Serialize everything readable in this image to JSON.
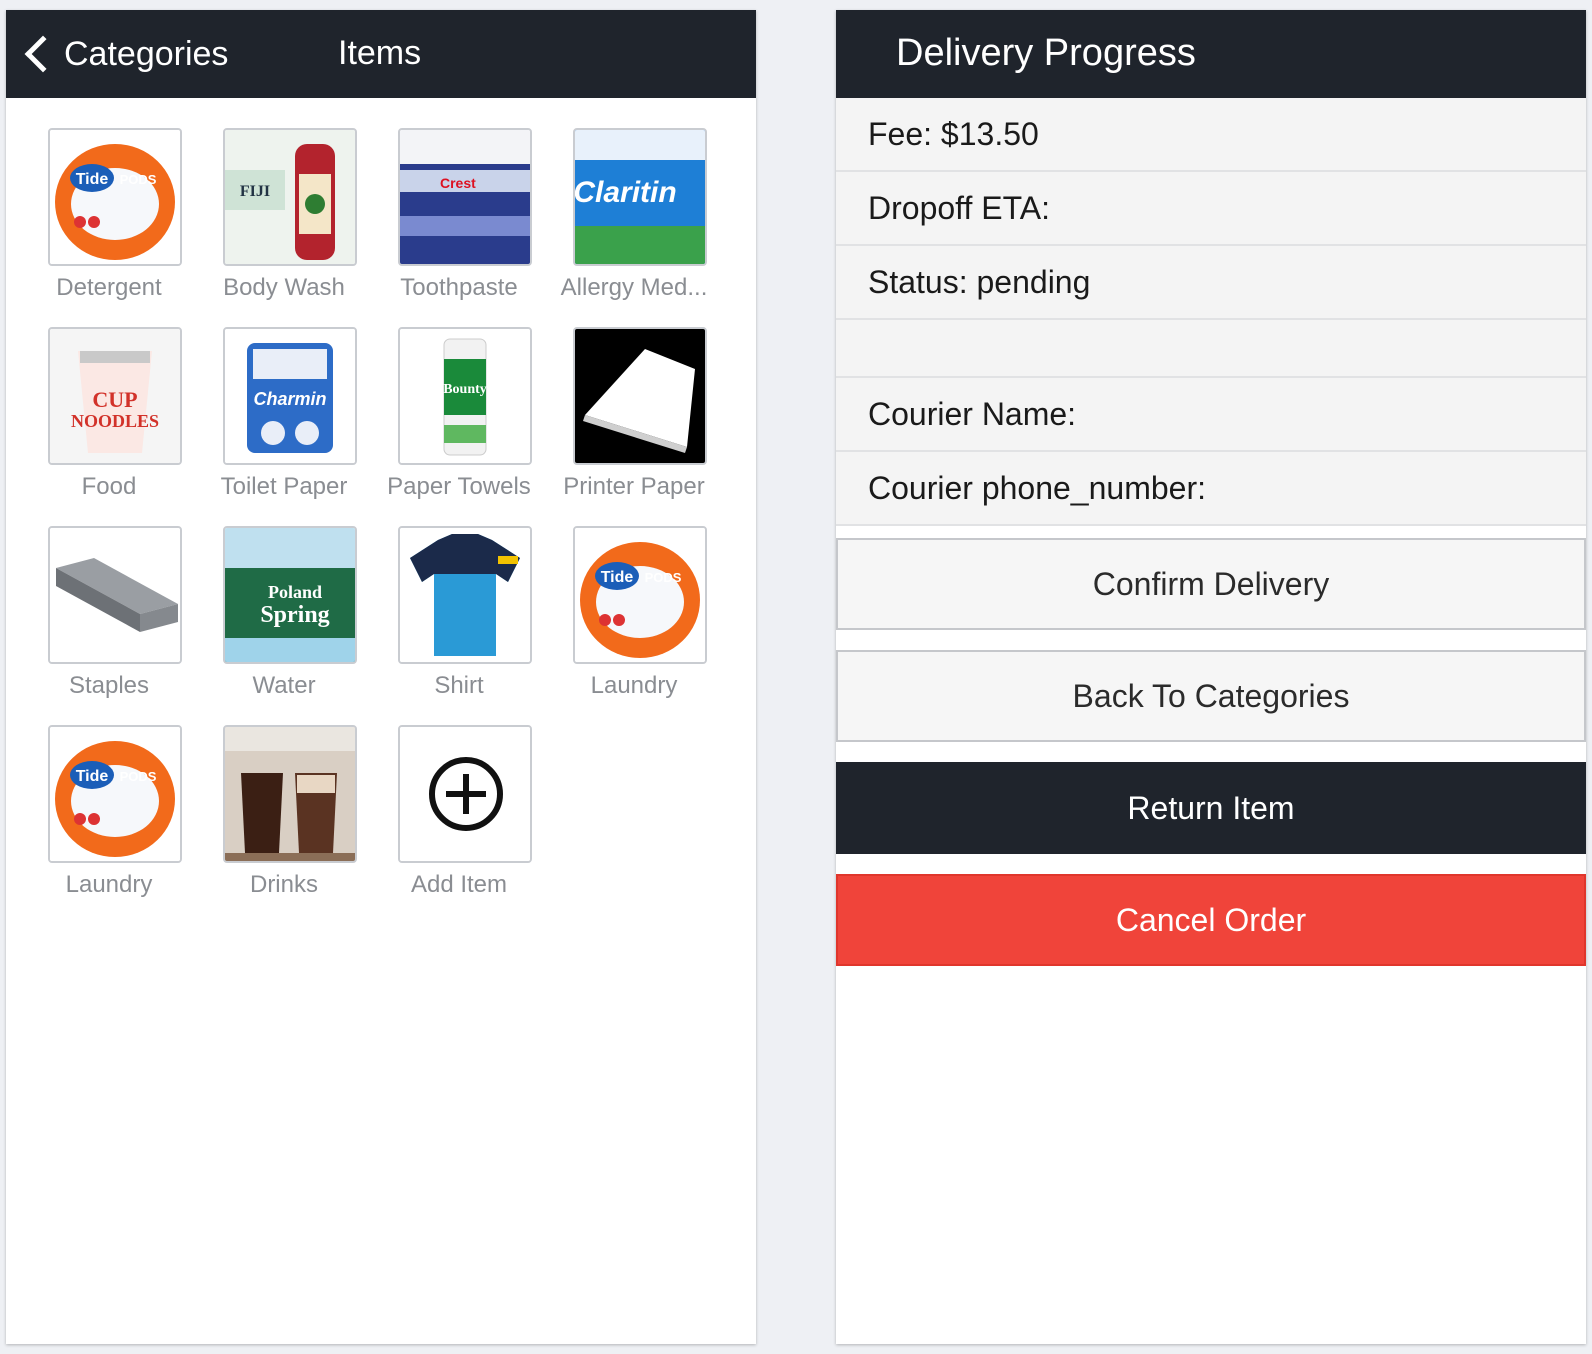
{
  "left_panel": {
    "nav": {
      "back_label": "Categories",
      "title": "Items"
    },
    "items": [
      {
        "label": "Detergent"
      },
      {
        "label": "Body Wash"
      },
      {
        "label": "Toothpaste"
      },
      {
        "label": "Allergy Med..."
      },
      {
        "label": "Food"
      },
      {
        "label": "Toilet Paper"
      },
      {
        "label": "Paper Towels"
      },
      {
        "label": "Printer Paper"
      },
      {
        "label": "Staples"
      },
      {
        "label": "Water"
      },
      {
        "label": "Shirt"
      },
      {
        "label": "Laundry"
      },
      {
        "label": "Laundry"
      },
      {
        "label": "Drinks"
      },
      {
        "label": "Add Item"
      }
    ]
  },
  "right_panel": {
    "title": "Delivery Progress",
    "fee": "Fee: $13.50",
    "dropoff_eta": "Dropoff ETA:",
    "status": "Status: pending",
    "courier_name": "Courier Name:",
    "courier_phone": "Courier phone_number:",
    "buttons": {
      "confirm": "Confirm Delivery",
      "back": "Back To Categories",
      "return": "Return Item",
      "cancel": "Cancel Order"
    }
  },
  "colors": {
    "navbar": "#1f242c",
    "cancel": "#f0443a",
    "label": "#8a8d92"
  }
}
